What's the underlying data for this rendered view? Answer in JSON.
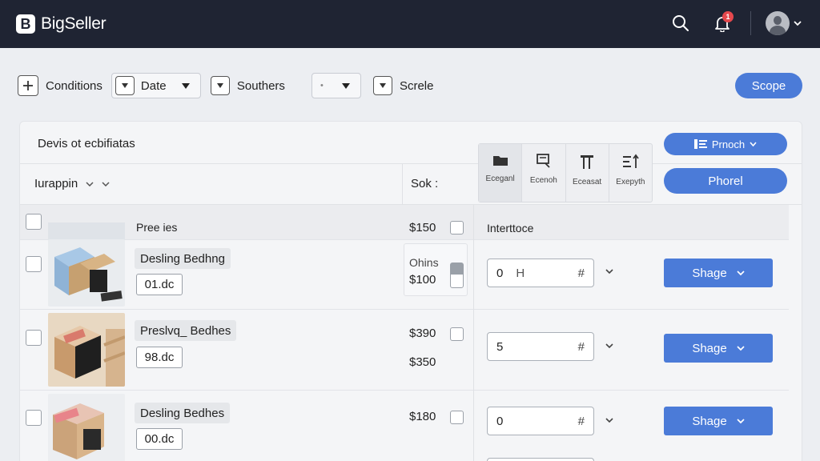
{
  "app": {
    "logo_letter": "B",
    "name": "BigSeller"
  },
  "topbar": {
    "notification_count": "1",
    "icons": [
      "search-icon",
      "bell-icon",
      "avatar",
      "chevron-down-icon"
    ]
  },
  "filters": {
    "conditions_label": "Conditions",
    "date_label": "Date",
    "southers_label": "Southers",
    "empty_select_value": "",
    "screle_label": "Screle",
    "scope_button": "Scope"
  },
  "panel": {
    "title": "Devis ot ecbifiatas",
    "action_button": "Prnoch",
    "primary_button": "Phorel",
    "sort_label": "Iurappin",
    "stock_header": "Sok :",
    "tools": [
      {
        "label": "Eceganl",
        "icon": "folder-icon"
      },
      {
        "label": "Ecenoh",
        "icon": "print-icon"
      },
      {
        "label": "Eceasat",
        "icon": "columns-icon"
      },
      {
        "label": "Exepyth",
        "icon": "sort-icon"
      }
    ]
  },
  "rows": [
    {
      "title": "Pree ies",
      "price": "$150",
      "section_label": "Interttoce"
    },
    {
      "name": "Desling Bedhng",
      "sku": "01.dc",
      "price_label": "Ohins",
      "price": "$100",
      "qty": "0",
      "qty_suffix": "H",
      "button": "Shage"
    },
    {
      "name": "Preslvq_ Bedhes",
      "sku": "98.dc",
      "price": "$390",
      "price2": "$350",
      "qty": "5",
      "button": "Shage"
    },
    {
      "name": "Desling Bedhes",
      "sku": "00.dc",
      "price": "$180",
      "qty": "0",
      "button": "Shage"
    }
  ]
}
